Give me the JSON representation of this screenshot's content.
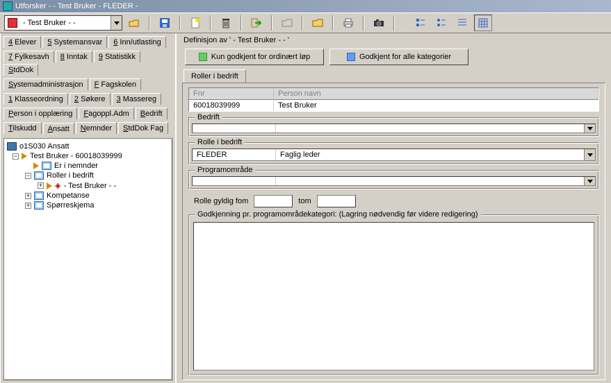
{
  "title": "Utforsker -  - Test Bruker - FLEDER -",
  "combo": {
    "text": " - Test Bruker -  - "
  },
  "left_tabs_rows": [
    [
      "4 Elever",
      "5 Systemansvar",
      "6 Inn/utlasting"
    ],
    [
      "7 Fylkesavh",
      "8 Inntak",
      "9 Statistikk",
      "StdDok"
    ],
    [
      "Systemadministrasjon",
      "F Fagskolen"
    ],
    [
      "1 Klasseordning",
      "2 Søkere",
      "3 Massereg"
    ],
    [
      "Person i opplæring",
      "Fagoppl.Adm",
      "Bedrift"
    ],
    [
      "Tilskudd",
      "Ansatt",
      "Nemnder",
      "StdDok Fag"
    ]
  ],
  "active_tab": "Ansatt",
  "tree": {
    "root": "o1S030 Ansatt",
    "person": "Test Bruker - 60018039999",
    "items": [
      "Er i nemnder",
      "Roller i bedrift",
      "Kompetanse",
      "Spørreskjema"
    ],
    "roller_child": " - Test Bruker -  - "
  },
  "definition_label": "Definisjon av ' - Test Bruker -  - '",
  "buttons": {
    "ordinary": "Kun godkjent for ordinært løp",
    "all": "Godkjent for alle kategorier"
  },
  "inner_tab": "Roller i bedrift",
  "fields": {
    "fnr_label": "Fnr",
    "fnr_value": "60018039999",
    "person_label": "Person navn",
    "person_value": "Test Bruker",
    "bedrift_label": "Bedrift",
    "bedrift_code": "",
    "bedrift_name": "",
    "rolle_label": "Rolle i bedrift",
    "rolle_code": "FLEDER",
    "rolle_name": "Faglig leder",
    "prog_label": "Programområde",
    "prog_code": "",
    "prog_name": ""
  },
  "date_row": {
    "fom_label": "Rolle gyldig fom",
    "tom_label": "tom"
  },
  "approval_group": "Godkjenning pr. programområdekategori: (Lagring nødvendig før videre redigering)"
}
